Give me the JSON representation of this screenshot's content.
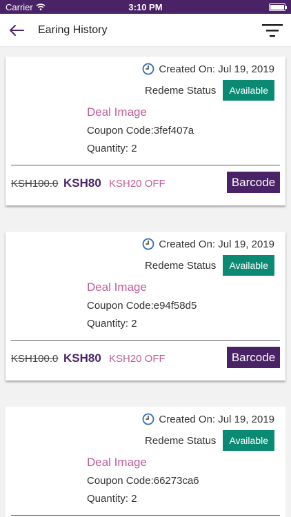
{
  "status_bar": {
    "carrier": "Carrier",
    "time": "3:10 PM"
  },
  "header": {
    "title": "Earing History"
  },
  "icons": {
    "back": "back-arrow-icon",
    "filter": "filter-icon",
    "clock": "clock-icon",
    "wifi": "wifi-icon",
    "battery": "battery-icon"
  },
  "colors": {
    "brand": "#4a2266",
    "status_available": "#0b8a73",
    "accent_pink": "#c25b9a"
  },
  "cards": [
    {
      "created": "Created On: Jul 19, 2019",
      "status_label": "Redeme Status",
      "status_value": "Available",
      "deal_image": "Deal Image",
      "coupon": "Coupon Code:3fef407a",
      "quantity": "Quantity: 2",
      "old_price": "KSH100.0",
      "new_price": "KSH80",
      "discount": "KSH20 OFF",
      "barcode_label": "Barcode"
    },
    {
      "created": "Created On: Jul 19, 2019",
      "status_label": "Redeme Status",
      "status_value": "Available",
      "deal_image": "Deal Image",
      "coupon": "Coupon Code:e94f58d5",
      "quantity": "Quantity: 2",
      "old_price": "KSH100.0",
      "new_price": "KSH80",
      "discount": "KSH20 OFF",
      "barcode_label": "Barcode"
    },
    {
      "created": "Created On: Jul 19, 2019",
      "status_label": "Redeme Status",
      "status_value": "Available",
      "deal_image": "Deal Image",
      "coupon": "Coupon Code:66273ca6",
      "quantity": "Quantity: 2"
    }
  ]
}
